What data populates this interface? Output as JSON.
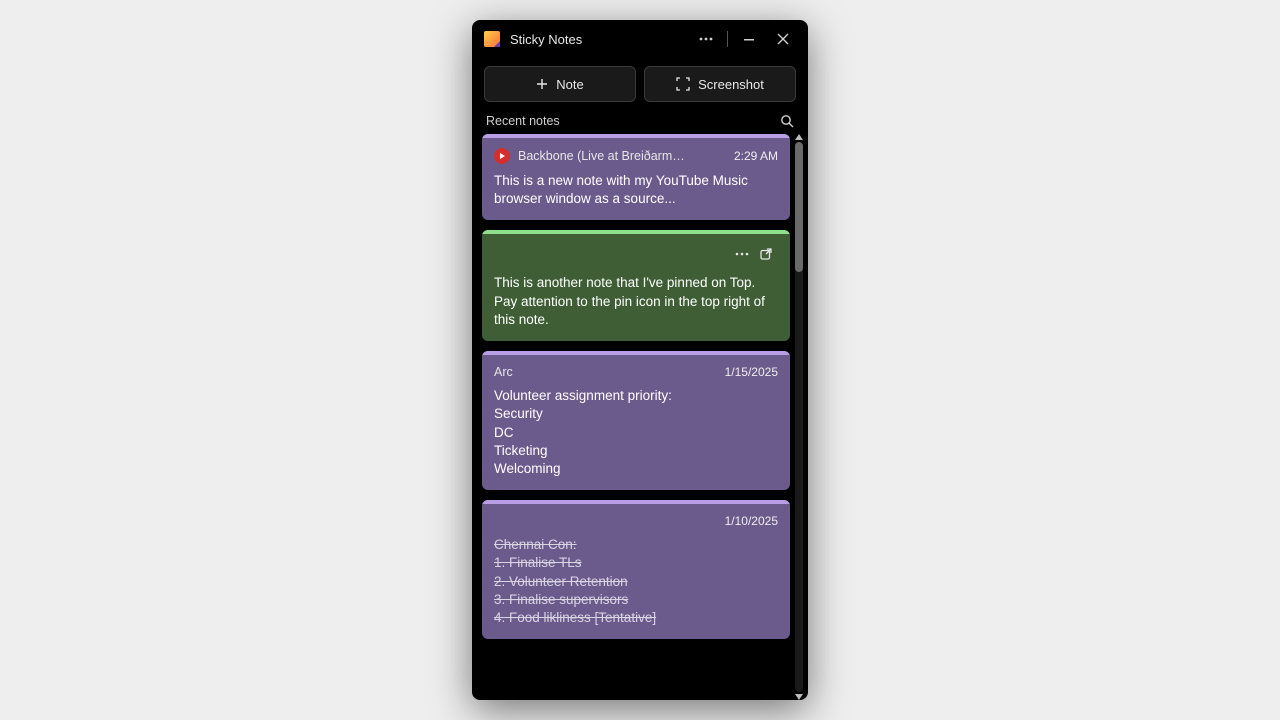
{
  "window": {
    "title": "Sticky Notes"
  },
  "actions": {
    "note_label": "Note",
    "screenshot_label": "Screenshot"
  },
  "section": {
    "recent_label": "Recent notes"
  },
  "notes": [
    {
      "accent": "purple",
      "source_title": "Backbone (Live at Breiðarmerk...",
      "time": "2:29 AM",
      "body": "This is a new note with my YouTube Music browser window as a source..."
    },
    {
      "accent": "green",
      "body": "This is another note that I've pinned on Top. Pay attention to the pin icon in the top right of this note."
    },
    {
      "accent": "purple",
      "source_title": "Arc",
      "time": "1/15/2025",
      "body_lines": [
        "Volunteer assignment priority:",
        "Security",
        "DC",
        "Ticketing",
        "Welcoming"
      ]
    },
    {
      "accent": "purple",
      "time": "1/10/2025",
      "strike_lines": [
        "Chennai Con:",
        "1. Finalise TLs",
        "2. Volunteer Retention",
        "3. Finalise supervisors",
        "4. Food likliness [Tentative]"
      ]
    }
  ]
}
